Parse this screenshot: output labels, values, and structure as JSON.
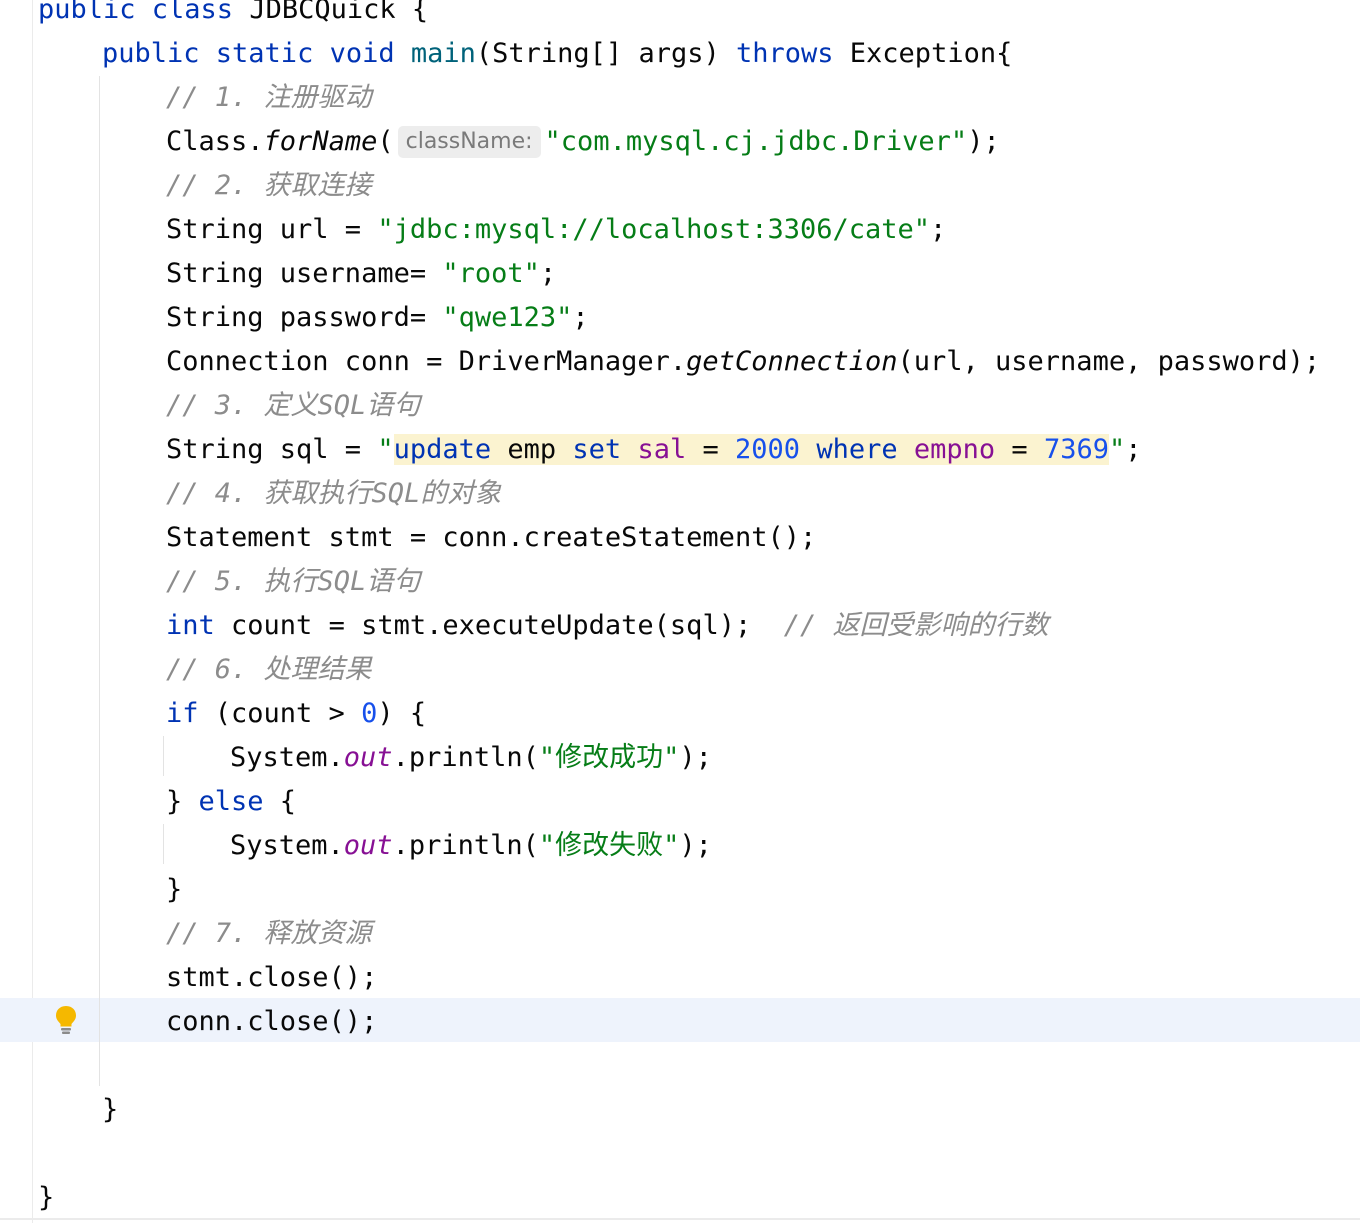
{
  "code": {
    "l0": {
      "kw1": "public class",
      "name": " JDBCQuick {"
    },
    "l1": {
      "kw1": "public static void",
      "method": " main",
      "rest1": "(String[] args) ",
      "kw2": "throws",
      "rest2": " Exception{"
    },
    "l2": {
      "comment": "// 1. 注册驱动"
    },
    "l3": {
      "a": "Class.",
      "m": "forName",
      "b": "(",
      "hint": "className:",
      "s": "\"com.mysql.cj.jdbc.Driver\"",
      "c": ");"
    },
    "l4": {
      "comment": "// 2. 获取连接"
    },
    "l5": {
      "a": "String url = ",
      "s": "\"jdbc:mysql://localhost:3306/cate\"",
      "c": ";"
    },
    "l6": {
      "a": "String username= ",
      "s": "\"root\"",
      "c": ";"
    },
    "l7": {
      "a": "String password= ",
      "s": "\"qwe123\"",
      "c": ";"
    },
    "l8": {
      "a": "Connection conn = DriverManager.",
      "m": "getConnection",
      "c": "(url, username, password);"
    },
    "l9": {
      "comment": "// 3. 定义SQL语句"
    },
    "l10": {
      "a": "String sql = ",
      "q1": "\"",
      "k1": "update",
      "t1": " emp ",
      "k2": "set",
      "t2": " ",
      "c1": "sal",
      "t3": " = ",
      "n1": "2000",
      "t4": " ",
      "k3": "where",
      "t5": " ",
      "c2": "empno",
      "t6": " = ",
      "n2": "7369",
      "q2": "\"",
      "e": ";"
    },
    "l11": {
      "comment": "// 4. 获取执行SQL的对象"
    },
    "l12": {
      "a": "Statement stmt = conn.createStatement();"
    },
    "l13": {
      "comment": "// 5. 执行SQL语句"
    },
    "l14": {
      "kw": "int",
      "a": " count = stmt.executeUpdate(sql);  ",
      "comment": "// 返回受影响的行数"
    },
    "l15": {
      "comment": "// 6. 处理结果"
    },
    "l16": {
      "kw": "if",
      "a": " (count > ",
      "n": "0",
      "b": ") {"
    },
    "l17": {
      "a": "System.",
      "f": "out",
      "b": ".println(",
      "s": "\"修改成功\"",
      "c": ");"
    },
    "l18": {
      "a": "} ",
      "kw": "else",
      "b": " {"
    },
    "l19": {
      "a": "System.",
      "f": "out",
      "b": ".println(",
      "s": "\"修改失败\"",
      "c": ");"
    },
    "l20": {
      "a": "}"
    },
    "l21": {
      "comment": "// 7. 释放资源"
    },
    "l22": {
      "a": "stmt.close();"
    },
    "l23": {
      "a": "conn.close();"
    },
    "l24": {
      "a": "}"
    },
    "l25": {
      "a": "}"
    }
  },
  "gutter": {
    "icon": "lightbulb-icon"
  },
  "colors": {
    "keyword": "#0033b3",
    "string": "#067d17",
    "number": "#1750eb",
    "comment": "#8c8c8c",
    "field": "#871094",
    "caret_line": "#eef3fc",
    "sql_highlight": "#fbf3d0"
  }
}
